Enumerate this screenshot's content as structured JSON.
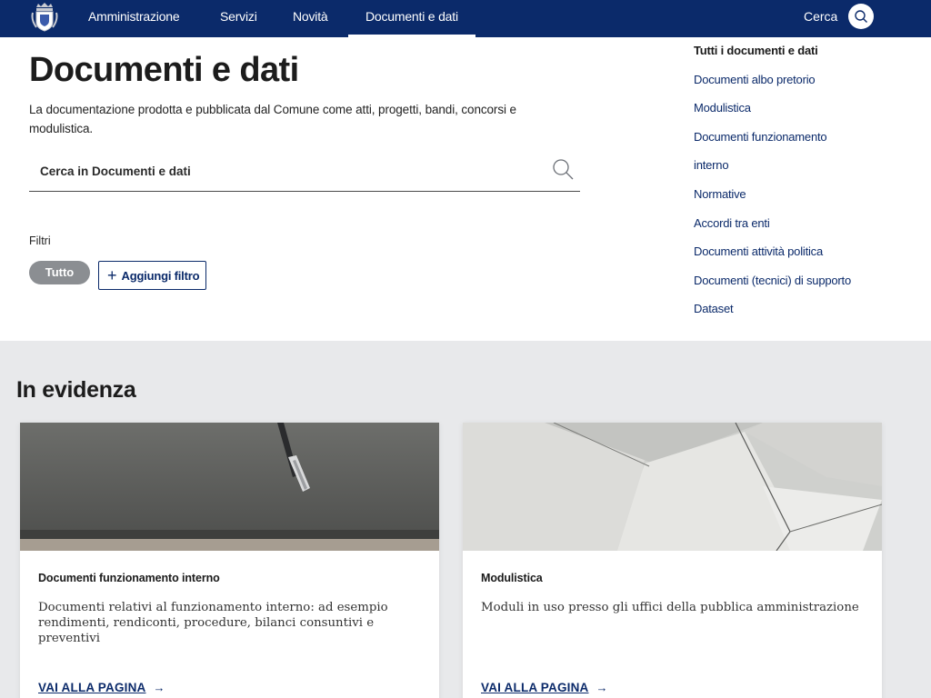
{
  "navbar": {
    "logo_icon": "municipal-crest-icon",
    "items": [
      {
        "label": "Amministrazione"
      },
      {
        "label": "Servizi"
      },
      {
        "label": "Novità"
      },
      {
        "label": "Documenti e dati"
      }
    ],
    "active_item": "Documenti e dati",
    "search_label": "Cerca",
    "search_icon": "search-icon",
    "background_color": "#0b2a6a"
  },
  "hero": {
    "title": "Documenti e dati",
    "description": "La documentazione prodotta e pubblicata dal Comune come atti, progetti, bandi, concorsi e modulistica.",
    "search": {
      "placeholder": "Cerca in Documenti e dati",
      "value": "",
      "icon": "search-icon"
    },
    "filters": {
      "label": "Filtri",
      "chip_all": "Tutto",
      "add_filter_label": "Aggiungi filtro",
      "add_icon": "plus-icon"
    }
  },
  "sidenav": {
    "items": [
      {
        "label": "Tutti i documenti e dati",
        "active": true
      },
      {
        "label": "Documenti albo pretorio"
      },
      {
        "label": "Modulistica"
      },
      {
        "label": "Documenti funzionamento"
      },
      {
        "label": "interno"
      },
      {
        "label": "Normative"
      },
      {
        "label": "Accordi tra enti"
      },
      {
        "label": "Documenti attività politica"
      },
      {
        "label": "Documenti (tecnici) di supporto"
      },
      {
        "label": "Dataset"
      }
    ]
  },
  "highlight": {
    "title": "In evidenza",
    "background_color": "#e8e9eb",
    "cards": [
      {
        "title": "Documenti funzionamento interno",
        "text": "Documenti relativi al funzionamento interno: ad esempio rendimenti, rendiconti, procedure, bilanci consuntivi e preventivi",
        "link_label": "VAI ALLA PAGINA",
        "link_icon": "arrow-right-icon",
        "image": "pen-on-dark-notebook-photo"
      },
      {
        "title": "Modulistica",
        "text": "Moduli in uso presso gli uffici della pubblica amministrazione",
        "link_label": "VAI ALLA PAGINA",
        "link_icon": "arrow-right-icon",
        "image": "white-paper-sheets-photo"
      }
    ]
  },
  "colors": {
    "primary": "#0b2a6a",
    "chip_gray": "#8b8e92",
    "text_dark": "#1c1c1c"
  }
}
